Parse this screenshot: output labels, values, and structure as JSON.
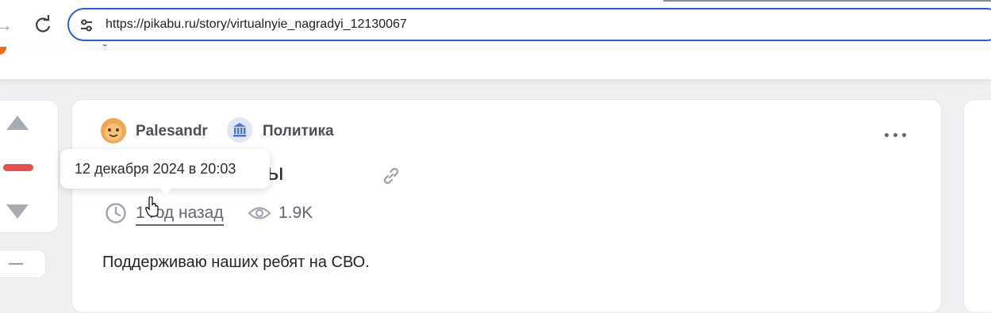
{
  "browser": {
    "url": "https://pikabu.ru/story/virtualnyie_nagradyi_12130067",
    "forward_icon": "arrow-right-icon",
    "reload_icon": "reload-icon",
    "site_info_icon": "tune-icon"
  },
  "vote": {
    "up_icon": "triangle-up-icon",
    "down_icon": "triangle-down-icon",
    "score_color": "#e3524c",
    "collapse_icon": "minus-icon"
  },
  "story": {
    "author": "Palesandr",
    "community": "Политика",
    "title": "награды",
    "time_ago": "1 год назад",
    "views": "1.9K",
    "body": "Поддерживаю наших ребят на СВО.",
    "more_icon": "more-horizontal-icon",
    "link_icon": "link-icon",
    "clock_icon": "clock-icon",
    "eye_icon": "eye-icon"
  },
  "tooltip": {
    "text": "12 декабря 2024 в 20:03"
  },
  "colors": {
    "accent": "#2b62c8",
    "brand": "#f26b1d",
    "avatar": "#f0a652"
  }
}
